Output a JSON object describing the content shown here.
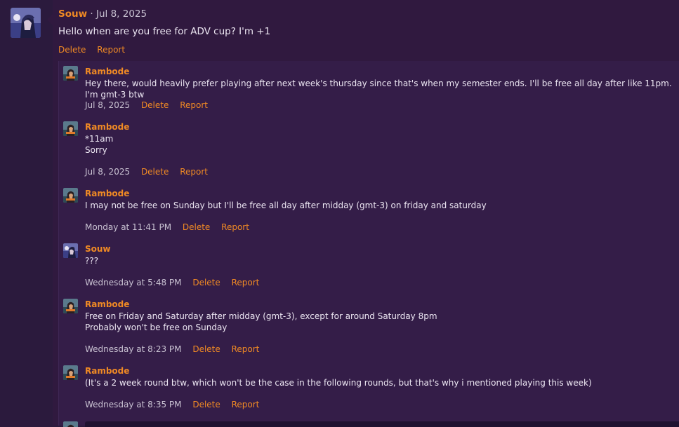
{
  "post": {
    "author": "Souw",
    "separator": "·",
    "date": "Jul 8, 2025",
    "text": "Hello when are you free for ADV cup? I'm +1",
    "actions": {
      "delete": "Delete",
      "report": "Report"
    }
  },
  "replies": [
    {
      "author": "Rambode",
      "avatar": "rambode",
      "lines": "Hey there, would heavily prefer playing after next week's thursday since that's when my semester ends. I'll be free all day after like 11pm. I'm gmt-3 btw",
      "date": "Jul 8, 2025",
      "delete": "Delete",
      "report": "Report"
    },
    {
      "author": "Rambode",
      "avatar": "rambode",
      "lines": "*11am\nSorry",
      "date": "Jul 8, 2025",
      "delete": "Delete",
      "report": "Report"
    },
    {
      "author": "Rambode",
      "avatar": "rambode",
      "lines": "I may not be free on Sunday but I'll be free all day after midday (gmt-3) on friday and saturday",
      "date": "Monday at 11:41 PM",
      "delete": "Delete",
      "report": "Report"
    },
    {
      "author": "Souw",
      "avatar": "souw",
      "lines": "???",
      "date": "Wednesday at 5:48 PM",
      "delete": "Delete",
      "report": "Report"
    },
    {
      "author": "Rambode",
      "avatar": "rambode",
      "lines": "Free on Friday and Saturday after midday (gmt-3), except for around Saturday 8pm\nProbably won't be free on Sunday",
      "date": "Wednesday at 8:23 PM",
      "delete": "Delete",
      "report": "Report"
    },
    {
      "author": "Rambode",
      "avatar": "rambode",
      "lines": "(It's a 2 week round btw, which won't be the case in the following rounds, but that's why i mentioned playing this week)",
      "date": "Wednesday at 8:35 PM",
      "delete": "Delete",
      "report": "Report"
    }
  ],
  "colors": {
    "accent": "#f08a24",
    "background": "#2b1a3d",
    "panel": "#30193f",
    "replies_bg": "#341d48"
  }
}
